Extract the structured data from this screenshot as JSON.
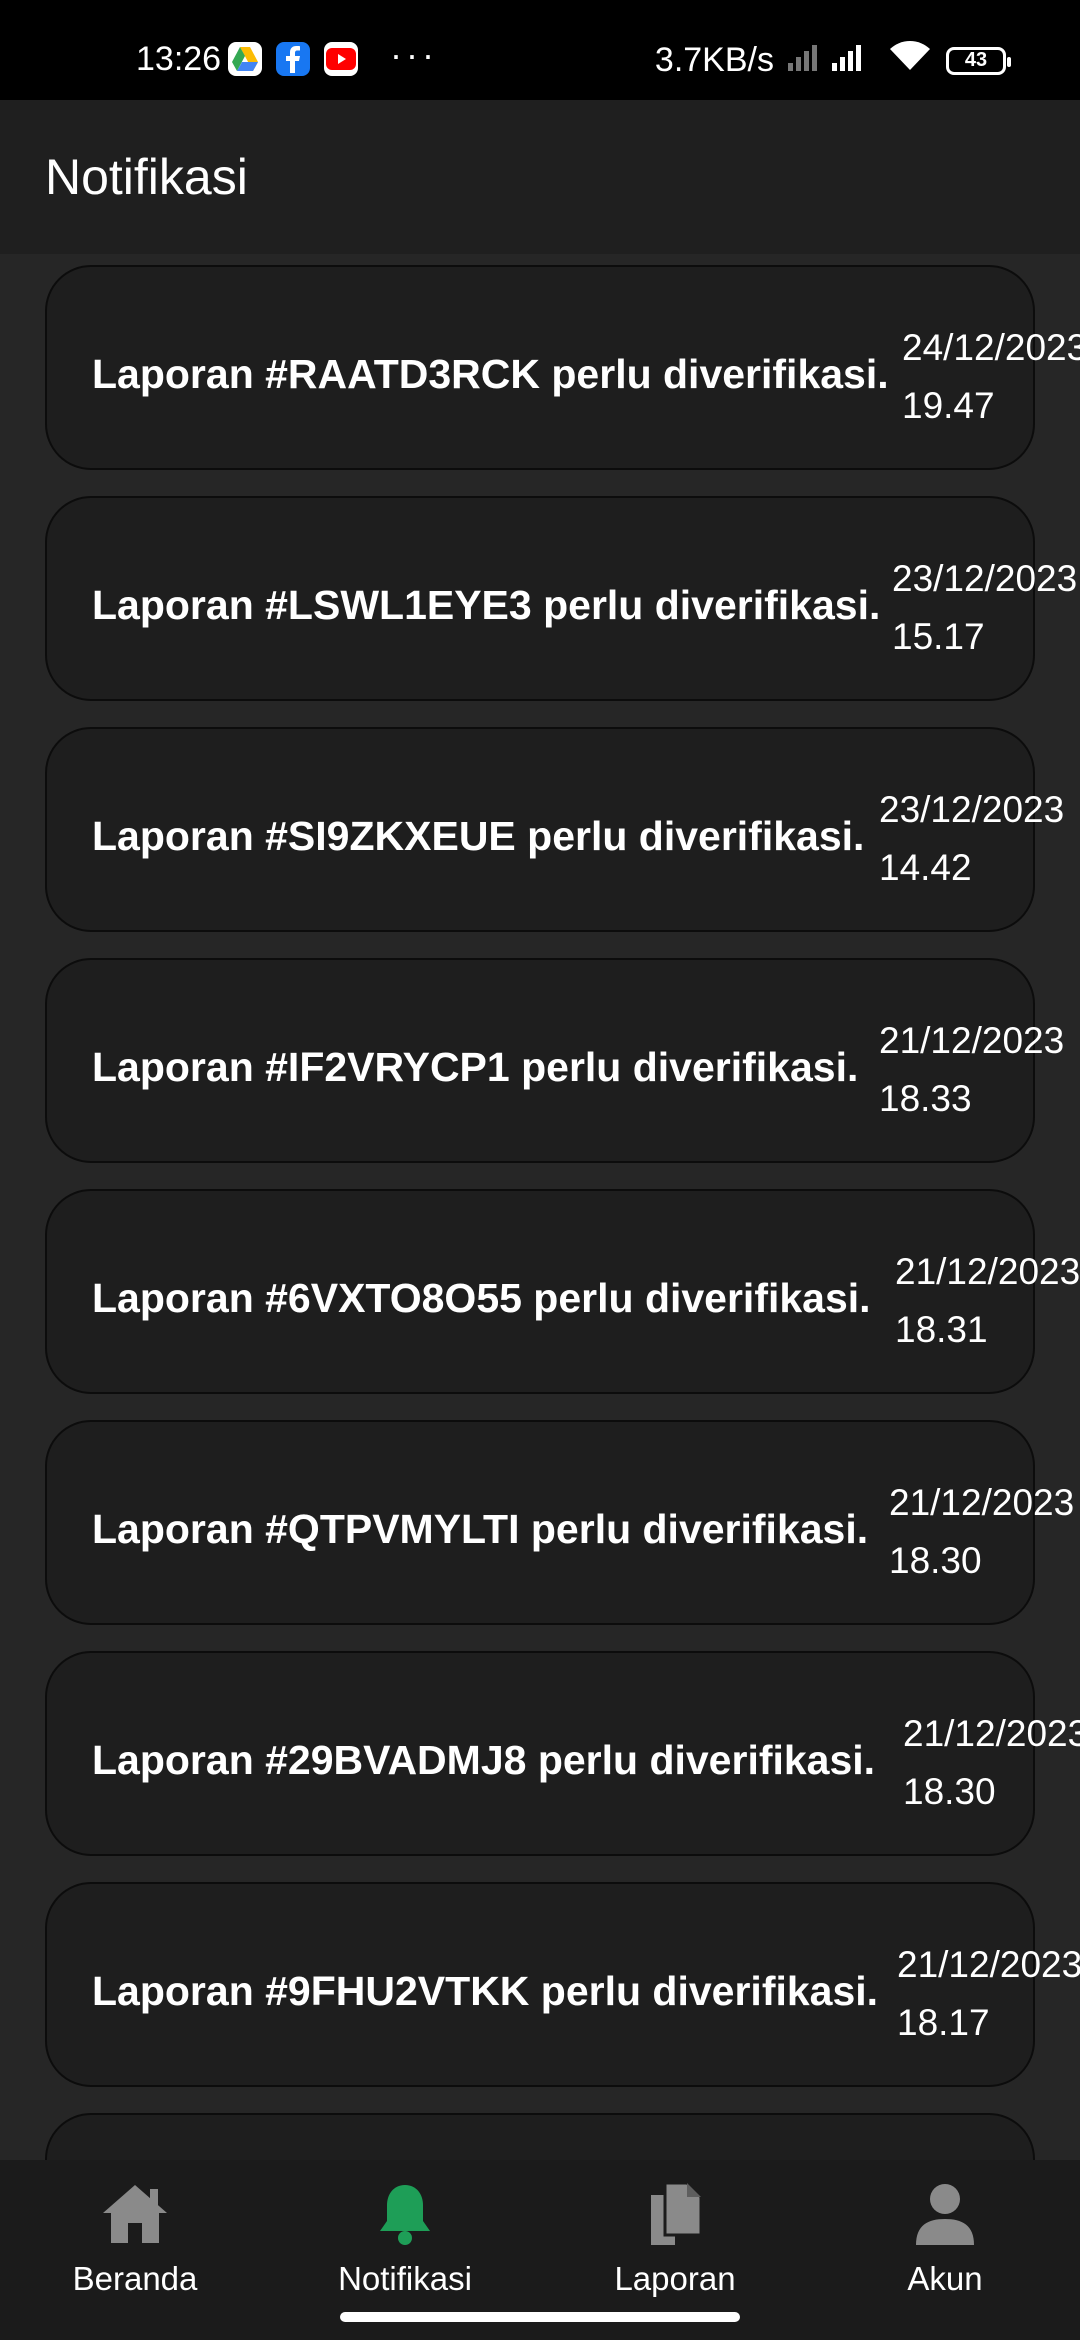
{
  "status_bar": {
    "time": "13:26",
    "network_speed": "3.7KB/s",
    "battery": "43",
    "icons": [
      "google-drive-icon",
      "facebook-icon",
      "youtube-icon",
      "more-dots-icon",
      "signal-icon",
      "wifi-icon",
      "battery-icon"
    ]
  },
  "app_bar": {
    "title": "Notifikasi"
  },
  "notifications": [
    {
      "message": "Laporan #RAATD3RCK perlu diverifikasi.",
      "date": "24/12/2023",
      "time": "19.47"
    },
    {
      "message": "Laporan #LSWL1EYE3 perlu diverifikasi.",
      "date": "23/12/2023",
      "time": "15.17"
    },
    {
      "message": "Laporan #SI9ZKXEUE perlu diverifikasi.",
      "date": "23/12/2023",
      "time": "14.42"
    },
    {
      "message": "Laporan #IF2VRYCP1 perlu diverifikasi.",
      "date": "21/12/2023",
      "time": "18.33"
    },
    {
      "message": "Laporan #6VXTO8O55 perlu diverifikasi.",
      "date": "21/12/2023",
      "time": "18.31"
    },
    {
      "message": "Laporan #QTPVMYLTI perlu diverifikasi.",
      "date": "21/12/2023",
      "time": "18.30"
    },
    {
      "message": "Laporan #29BVADMJ8 perlu diverifikasi.",
      "date": "21/12/2023",
      "time": "18.30"
    },
    {
      "message": "Laporan #9FHU2VTKK perlu diverifikasi.",
      "date": "21/12/2023",
      "time": "18.17"
    }
  ],
  "bottom_nav": {
    "items": [
      {
        "label": "Beranda",
        "icon": "home-icon",
        "active": false
      },
      {
        "label": "Notifikasi",
        "icon": "bell-icon",
        "active": true
      },
      {
        "label": "Laporan",
        "icon": "documents-icon",
        "active": false
      },
      {
        "label": "Akun",
        "icon": "person-icon",
        "active": false
      }
    ],
    "active_color": "#1e9e57",
    "inactive_color": "#8a8a8a"
  }
}
